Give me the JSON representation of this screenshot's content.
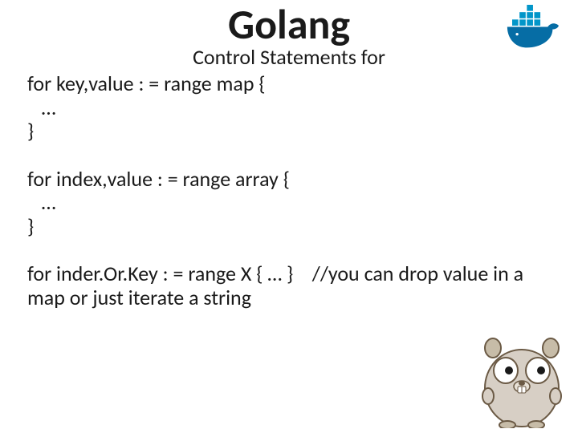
{
  "title": "Golang",
  "subtitle": "Control Statements  for",
  "code": "for key,value : = range map {\n   …\n}\n\nfor index,value : = range array {\n   …\n}\n\nfor inder.Or.Key : = range X { … }    //you can drop value in a map or just iterate a string",
  "icons": {
    "docker": "docker-whale-icon",
    "gopher": "go-gopher-mascot-icon"
  },
  "colors": {
    "docker_blue": "#0296c9",
    "docker_dark": "#066da5",
    "gopher_body": "#d7cfc5",
    "gopher_ear": "#c7bca8",
    "gopher_eye": "#ffffff",
    "gopher_nose": "#6b5a45"
  }
}
